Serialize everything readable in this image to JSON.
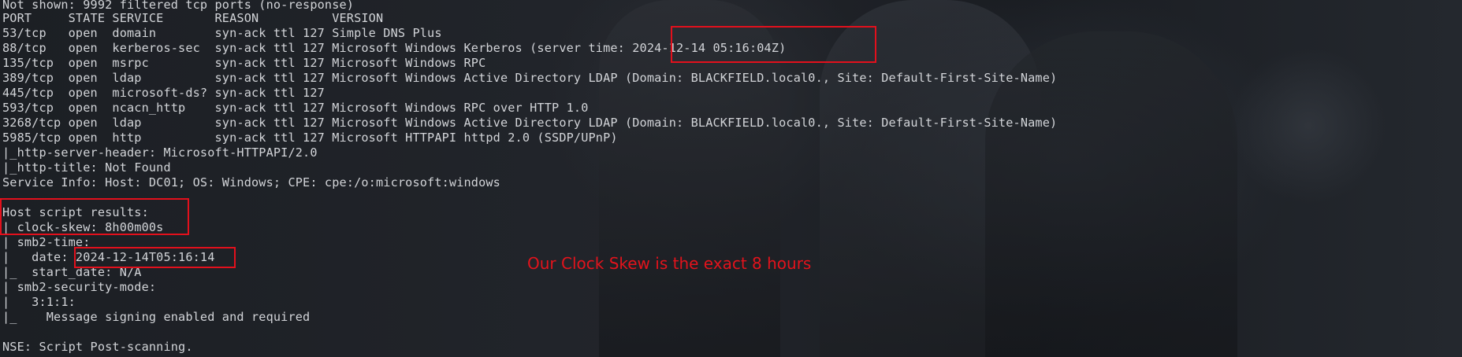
{
  "terminal": {
    "lines": [
      "Not shown: 9992 filtered tcp ports (no-response)",
      "PORT     STATE SERVICE       REASON          VERSION",
      "53/tcp   open  domain        syn-ack ttl 127 Simple DNS Plus",
      "88/tcp   open  kerberos-sec  syn-ack ttl 127 Microsoft Windows Kerberos (server time: 2024-12-14 05:16:04Z)",
      "135/tcp  open  msrpc         syn-ack ttl 127 Microsoft Windows RPC",
      "389/tcp  open  ldap          syn-ack ttl 127 Microsoft Windows Active Directory LDAP (Domain: BLACKFIELD.local0., Site: Default-First-Site-Name)",
      "445/tcp  open  microsoft-ds? syn-ack ttl 127",
      "593/tcp  open  ncacn_http    syn-ack ttl 127 Microsoft Windows RPC over HTTP 1.0",
      "3268/tcp open  ldap          syn-ack ttl 127 Microsoft Windows Active Directory LDAP (Domain: BLACKFIELD.local0., Site: Default-First-Site-Name)",
      "5985/tcp open  http          syn-ack ttl 127 Microsoft HTTPAPI httpd 2.0 (SSDP/UPnP)",
      "|_http-server-header: Microsoft-HTTPAPI/2.0",
      "|_http-title: Not Found",
      "Service Info: Host: DC01; OS: Windows; CPE: cpe:/o:microsoft:windows",
      "",
      "Host script results:",
      "|_clock-skew: 8h00m00s",
      "| smb2-time:",
      "|   date: 2024-12-14T05:16:14",
      "|_  start_date: N/A",
      "| smb2-security-mode:",
      "|   3:1:1:",
      "|_    Message signing enabled and required",
      "",
      "NSE: Script Post-scanning."
    ]
  },
  "annotation": {
    "text": "Our Clock Skew is the exact 8 hours",
    "color": "#e3131c"
  },
  "highlight_color": "#e3101c"
}
